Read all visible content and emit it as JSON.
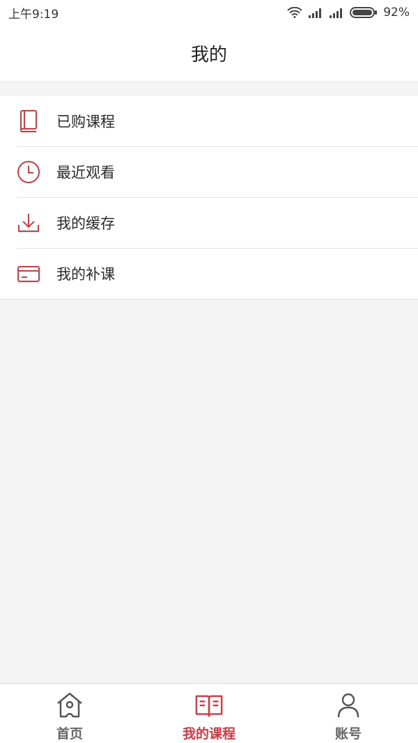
{
  "statusbar": {
    "time": "上午9:19",
    "battery": "92%"
  },
  "header": {
    "title": "我的"
  },
  "menu": {
    "items": [
      {
        "label": "已购课程",
        "icon": "book-icon"
      },
      {
        "label": "最近观看",
        "icon": "clock-icon"
      },
      {
        "label": "我的缓存",
        "icon": "download-icon"
      },
      {
        "label": "我的补课",
        "icon": "card-icon"
      }
    ]
  },
  "tabbar": {
    "tabs": [
      {
        "label": "首页",
        "icon": "home-icon",
        "active": false
      },
      {
        "label": "我的课程",
        "icon": "open-book-icon",
        "active": true
      },
      {
        "label": "账号",
        "icon": "user-icon",
        "active": false
      }
    ]
  },
  "colors": {
    "accent": "#d8383e",
    "text": "#2a2a2a",
    "background": "#f4f4f4"
  }
}
